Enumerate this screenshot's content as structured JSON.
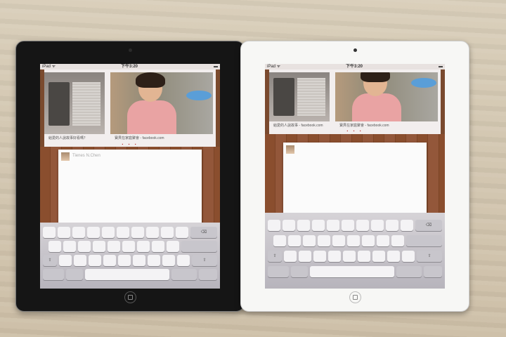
{
  "scene": {
    "description_colors": {
      "table": "#d3c7b1",
      "black_bezel": "#151515",
      "white_bezel": "#f7f7f5",
      "wood_panel": "#8a4e2e"
    }
  },
  "tablets": [
    {
      "id": "black",
      "status_left": "iPad ᯤ",
      "status_center": "下午3:20",
      "status_right": "▬",
      "caption_left": "給愛的人說故事好看嗎？",
      "caption_right": "寶貝在家庭聚會 - facebook.com",
      "compose_name": "Tienes N.Chen"
    },
    {
      "id": "white",
      "status_left": "iPad ᯤ",
      "status_center": "下午3:20",
      "status_right": "▬",
      "caption_left": "給愛的人說故事 - facebook.com",
      "caption_right": "寶貝在家庭聚會 - facebook.com",
      "compose_name": ""
    }
  ]
}
